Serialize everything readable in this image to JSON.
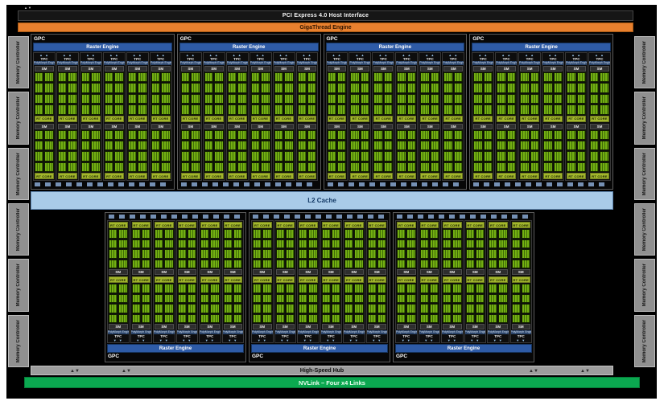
{
  "pci": {
    "label": "PCI Express 4.0 Host Interface"
  },
  "gigathread": {
    "label": "GigaThread Engine"
  },
  "memory_controller": {
    "label": "Memory Controller",
    "bars_per_side": 6
  },
  "gpc": {
    "label": "GPC",
    "raster": "Raster Engine",
    "tpc": "TPC",
    "polymorph": "PolyMorph Engine",
    "sm": "SM",
    "rt_core": "RT CORE",
    "top_count": 4,
    "bottom_count": 3,
    "tpcs_per_gpc": 6,
    "sms_per_tpc": 2,
    "core_cells_per_sm": 8
  },
  "l2": {
    "label": "L2 Cache"
  },
  "hub": {
    "label": "High-Speed Hub"
  },
  "nvlink": {
    "label": "NVLink – Four x4 Links"
  },
  "icons": {
    "up_arrows": "▲ ▲",
    "down_arrows": "▼ ▼",
    "updown_arrows": "▲▼"
  },
  "colors": {
    "gigathread_orange": "#e8802e",
    "raster_blue": "#2e5ba6",
    "core_green": "#73af12",
    "core_green_dark": "#3f6b07",
    "rt_core_green": "#a3b72c",
    "l2_blue": "#a9cbe8",
    "nvlink_green": "#0ba850",
    "memory_gray": "#909090",
    "dash_blue": "#7590b4",
    "polymorph_navy": "#2b4469"
  }
}
